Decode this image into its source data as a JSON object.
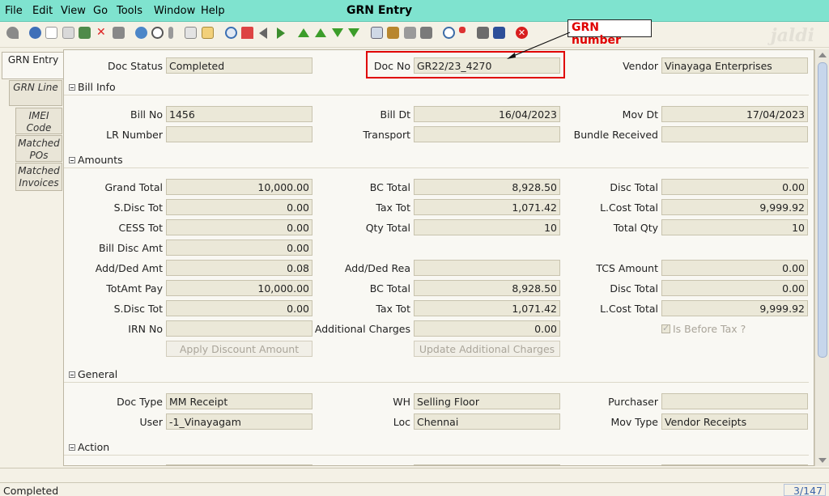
{
  "menu": {
    "items": [
      "File",
      "Edit",
      "View",
      "Go",
      "Tools",
      "Window",
      "Help"
    ]
  },
  "window": {
    "title": "GRN Entry"
  },
  "toolbar": {
    "logo_text": "jaldi"
  },
  "annotation": {
    "label": "GRN number"
  },
  "tabs": [
    {
      "label": "GRN Entry"
    },
    {
      "label": "GRN Line"
    },
    {
      "label": "IMEI Code"
    },
    {
      "label": "Matched POs"
    },
    {
      "label": "Matched Invoices"
    }
  ],
  "header": {
    "doc_status_label": "Doc Status",
    "doc_status": "Completed",
    "doc_no_label": "Doc No",
    "doc_no": "GR22/23_4270",
    "vendor_label": "Vendor",
    "vendor": "Vinayaga Enterprises"
  },
  "bill_info": {
    "title": "Bill Info",
    "bill_no_label": "Bill No",
    "bill_no": "1456",
    "bill_dt_label": "Bill Dt",
    "bill_dt": "16/04/2023",
    "mov_dt_label": "Mov Dt",
    "mov_dt": "17/04/2023",
    "lr_number_label": "LR Number",
    "lr_number": "",
    "transport_label": "Transport",
    "transport": "",
    "bundle_received_label": "Bundle Received",
    "bundle_received": ""
  },
  "amounts": {
    "title": "Amounts",
    "grand_total_label": "Grand Total",
    "grand_total": "10,000.00",
    "bc_total_label": "BC Total",
    "bc_total": "8,928.50",
    "disc_total_label": "Disc Total",
    "disc_total": "0.00",
    "sdisc_tot_label": "S.Disc Tot",
    "sdisc_tot": "0.00",
    "tax_tot_label": "Tax Tot",
    "tax_tot": "1,071.42",
    "lcost_total_label": "L.Cost Total",
    "lcost_total": "9,999.92",
    "cess_tot_label": "CESS Tot",
    "cess_tot": "0.00",
    "qty_total_label": "Qty Total",
    "qty_total": "10",
    "total_qty_label": "Total Qty",
    "total_qty": "10",
    "bill_disc_amt_label": "Bill Disc Amt",
    "bill_disc_amt": "0.00",
    "add_ded_amt_label": "Add/Ded Amt",
    "add_ded_amt": "0.08",
    "add_ded_rea_label": "Add/Ded Rea",
    "add_ded_rea": "",
    "tcs_amount_label": "TCS Amount",
    "tcs_amount": "0.00",
    "totamt_pay_label": "TotAmt Pay",
    "totamt_pay": "10,000.00",
    "bc_total2_label": "BC Total",
    "bc_total2": "8,928.50",
    "disc_total2_label": "Disc Total",
    "disc_total2": "0.00",
    "sdisc_tot2_label": "S.Disc Tot",
    "sdisc_tot2": "0.00",
    "tax_tot2_label": "Tax Tot",
    "tax_tot2": "1,071.42",
    "lcost_total2_label": "L.Cost Total",
    "lcost_total2": "9,999.92",
    "irn_no_label": "IRN No",
    "irn_no": "",
    "additional_charges_label": "Additional Charges",
    "additional_charges": "0.00",
    "is_before_tax_label": "Is Before Tax ?",
    "apply_discount_label": "Apply Discount Amount",
    "update_charges_label": "Update Additional Charges"
  },
  "general": {
    "title": "General",
    "doc_type_label": "Doc Type",
    "doc_type": "MM Receipt",
    "wh_label": "WH",
    "wh": "Selling Floor",
    "purchaser_label": "Purchaser",
    "purchaser": "",
    "user_label": "User",
    "user": "-1_Vinayagam",
    "loc_label": "Loc",
    "loc": "Chennai",
    "mov_type_label": "Mov Type",
    "mov_type": "Vendor Receipts"
  },
  "action": {
    "title": "Action"
  },
  "status": {
    "text": "Completed",
    "record_count": "3/147"
  },
  "colors": {
    "menubar": "#7fe3cf",
    "background": "#f4f1e6",
    "field": "#ebe8d8",
    "annotation_red": "#e00000"
  }
}
